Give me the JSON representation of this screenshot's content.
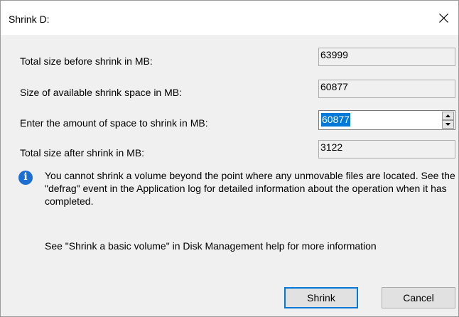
{
  "window": {
    "title": "Shrink D:",
    "close_icon": "close-icon"
  },
  "fields": {
    "total_before_label": "Total size before shrink in MB:",
    "total_before_value": "63999",
    "available_label": "Size of available shrink space in MB:",
    "available_value": "60877",
    "enter_amount_label": "Enter the amount of space to shrink in MB:",
    "enter_amount_value": "60877",
    "total_after_label": "Total size after shrink in MB:",
    "total_after_value": "3122"
  },
  "info": {
    "icon": "info-icon",
    "message": "You cannot shrink a volume beyond the point where any unmovable files are located. See the \"defrag\" event in the Application log for detailed information about the operation when it has completed.",
    "help": "See \"Shrink a basic volume\" in Disk Management help for more information"
  },
  "buttons": {
    "shrink_label": "Shrink",
    "cancel_label": "Cancel"
  },
  "colors": {
    "selection": "#0078d7",
    "info_icon": "#1c6fd1",
    "body_background": "#f0f0f0"
  }
}
